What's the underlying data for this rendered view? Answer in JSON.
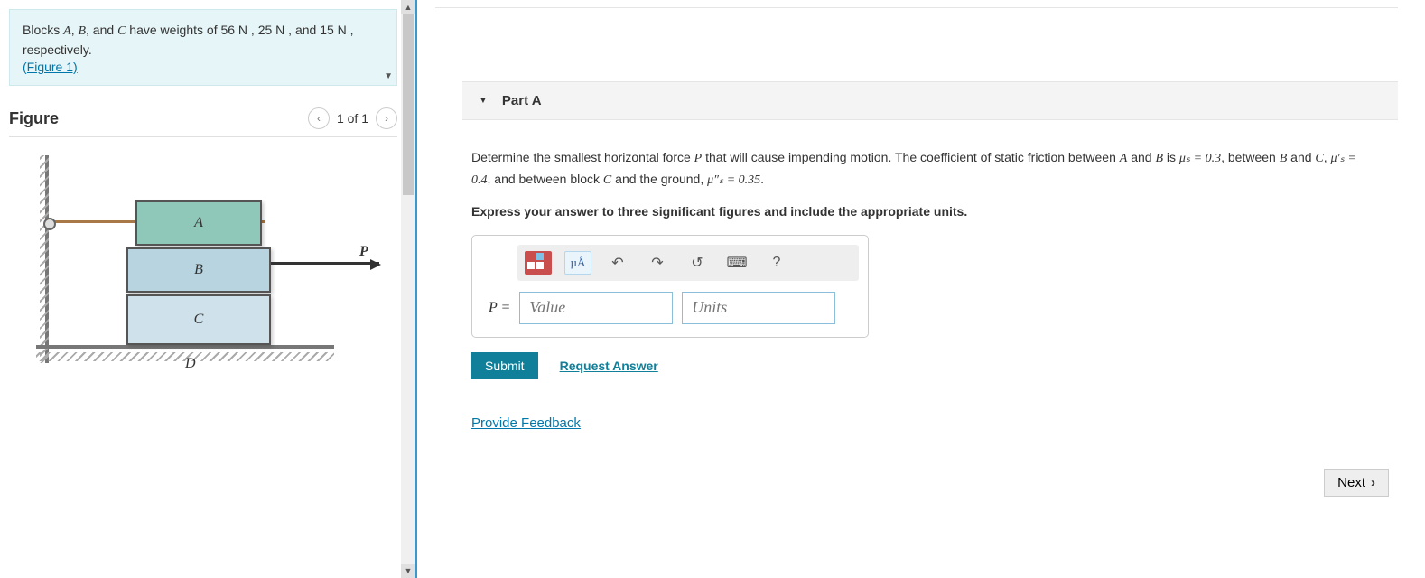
{
  "problem": {
    "segments": [
      {
        "t": "text",
        "v": "Blocks "
      },
      {
        "t": "var",
        "v": "A"
      },
      {
        "t": "text",
        "v": ", "
      },
      {
        "t": "var",
        "v": "B"
      },
      {
        "t": "text",
        "v": ", and "
      },
      {
        "t": "var",
        "v": "C"
      },
      {
        "t": "text",
        "v": " have weights of 56 N , 25 N , and 15 N , respectively."
      }
    ],
    "figure_link": "(Figure 1)"
  },
  "figure": {
    "title": "Figure",
    "counter": "1 of 1",
    "labels": {
      "A": "A",
      "B": "B",
      "C": "C",
      "D": "D",
      "P": "P"
    }
  },
  "part": {
    "title": "Part A",
    "question_segments": [
      {
        "t": "text",
        "v": "Determine the smallest horizontal force "
      },
      {
        "t": "var",
        "v": "P"
      },
      {
        "t": "text",
        "v": " that will cause impending motion. The coefficient of static friction between "
      },
      {
        "t": "var",
        "v": "A"
      },
      {
        "t": "text",
        "v": " and "
      },
      {
        "t": "var",
        "v": "B"
      },
      {
        "t": "text",
        "v": " is "
      },
      {
        "t": "math",
        "v": "μ_s = 0.3"
      },
      {
        "t": "text",
        "v": ", between "
      },
      {
        "t": "var",
        "v": "B"
      },
      {
        "t": "text",
        "v": " and "
      },
      {
        "t": "var",
        "v": "C"
      },
      {
        "t": "text",
        "v": ", "
      },
      {
        "t": "math",
        "v": "μ′_s = 0.4"
      },
      {
        "t": "text",
        "v": ", and between block "
      },
      {
        "t": "var",
        "v": "C"
      },
      {
        "t": "text",
        "v": " and the ground, "
      },
      {
        "t": "math",
        "v": "μ″_s = 0.35"
      },
      {
        "t": "text",
        "v": "."
      }
    ],
    "instruction": "Express your answer to three significant figures and include the appropriate units.",
    "equation_label": "P =",
    "value_placeholder": "Value",
    "units_placeholder": "Units",
    "submit_label": "Submit",
    "request_answer_label": "Request Answer",
    "toolbar": {
      "templates_tip": "templates",
      "symbols_label": "µÅ",
      "undo": "↶",
      "redo": "↷",
      "reset": "↺",
      "keyboard": "⌨",
      "help": "?"
    }
  },
  "footer": {
    "feedback": "Provide Feedback",
    "next": "Next"
  }
}
